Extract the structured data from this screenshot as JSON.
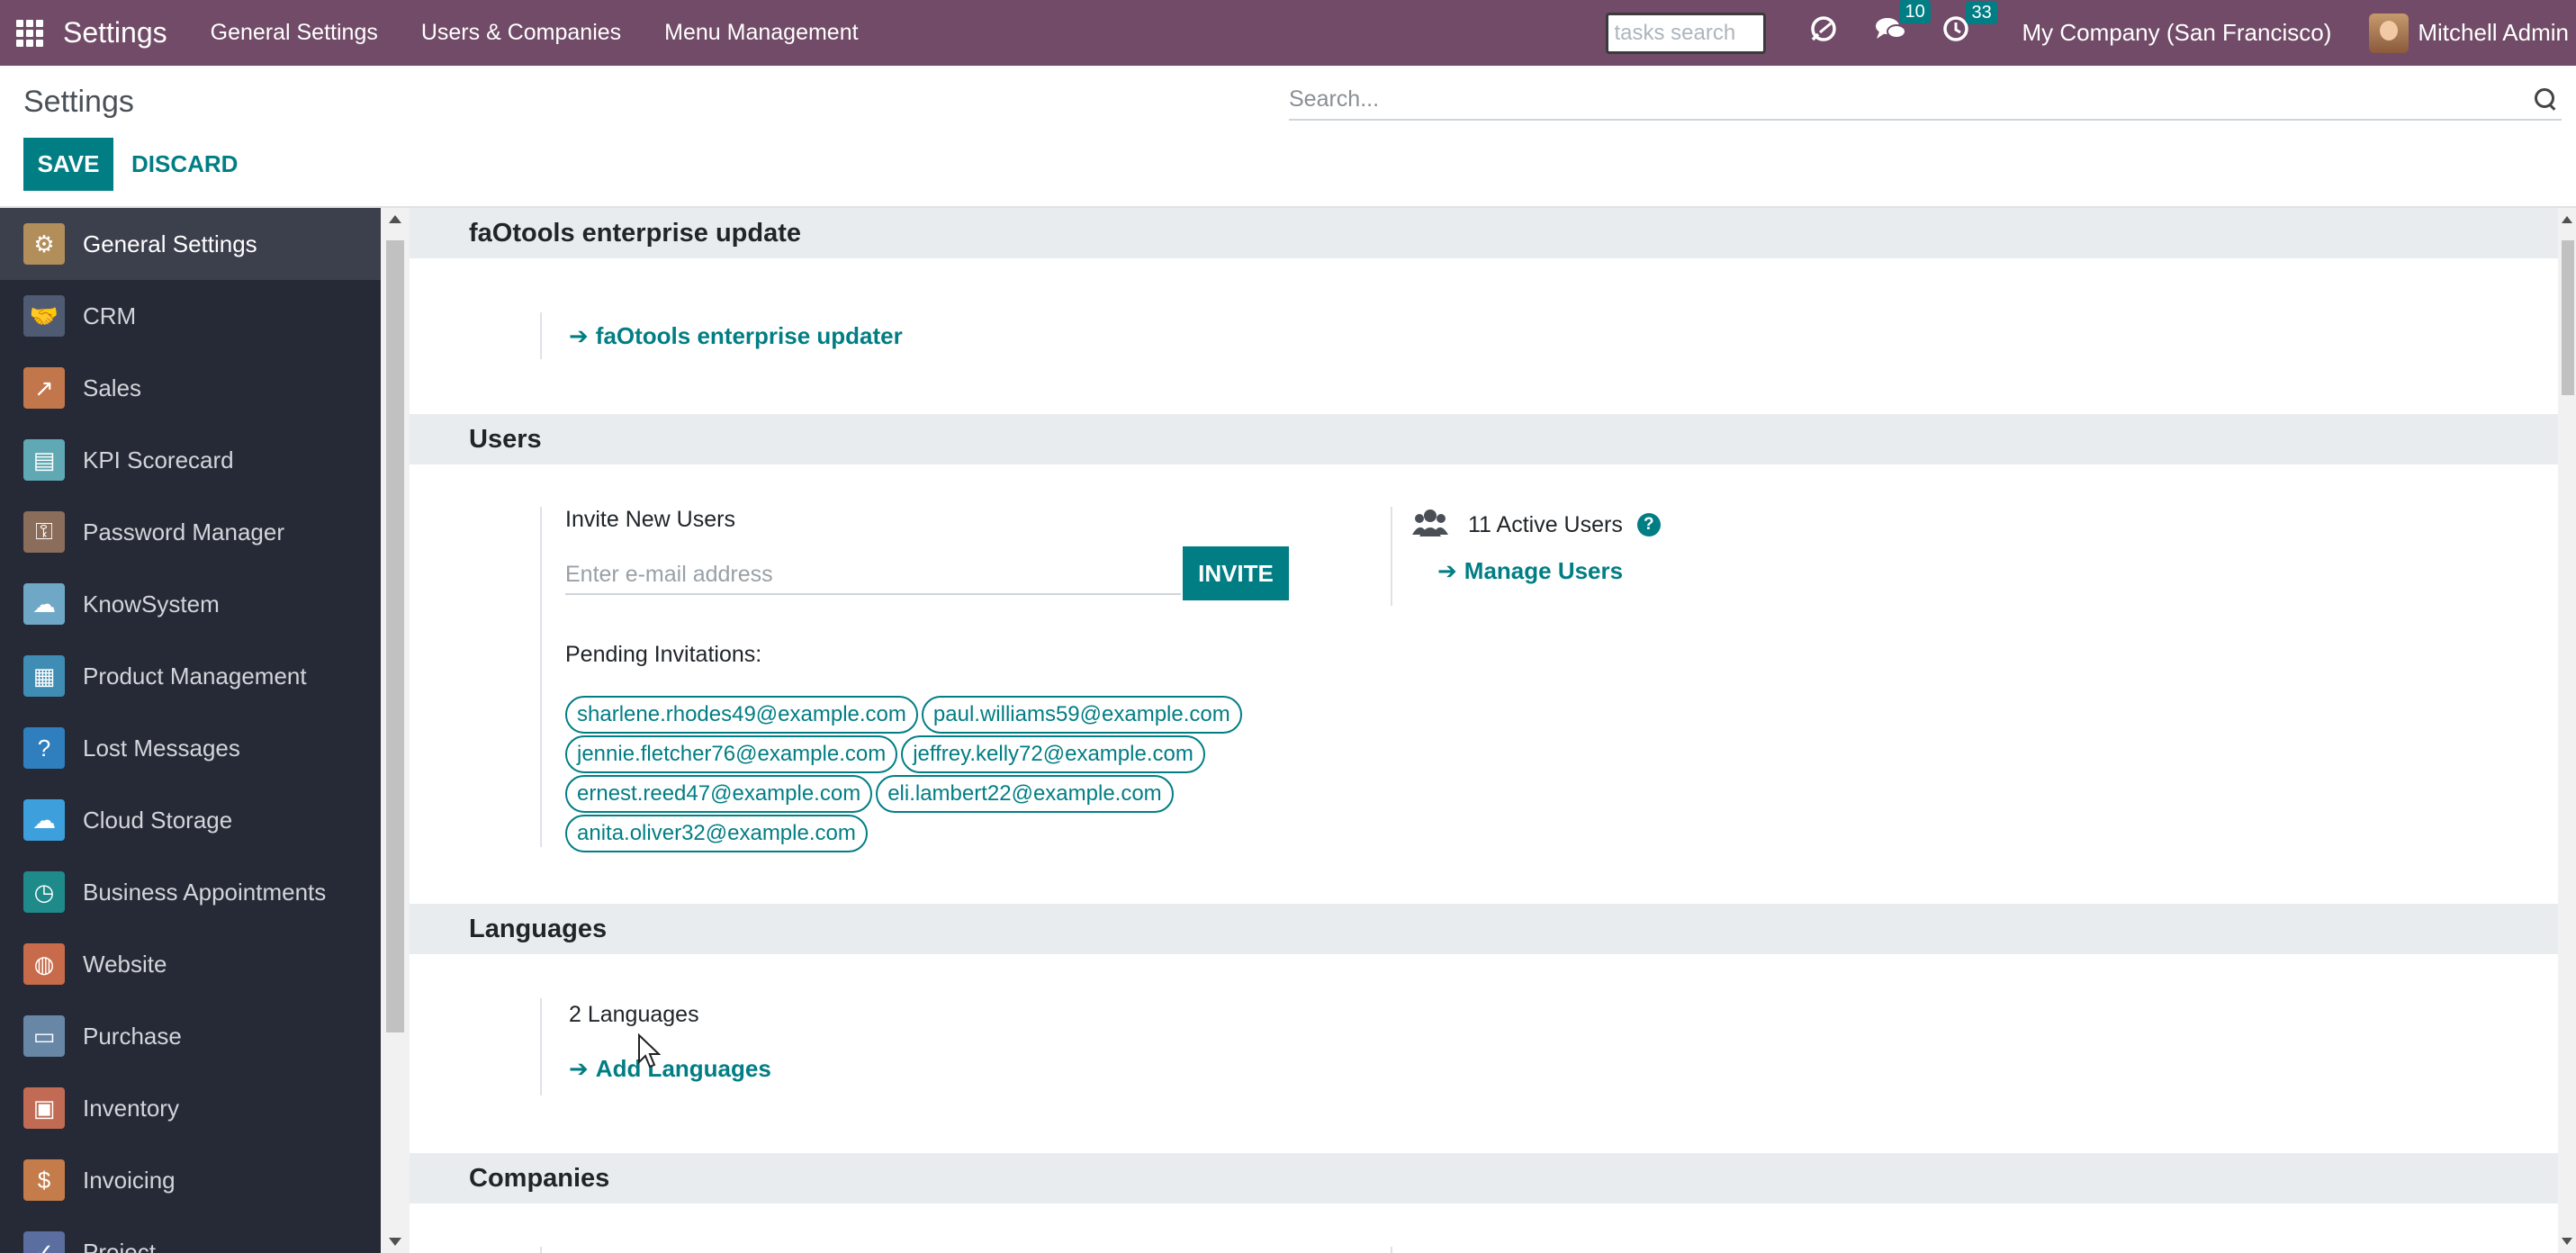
{
  "navbar": {
    "app_title": "Settings",
    "menus": [
      "General Settings",
      "Users & Companies",
      "Menu Management"
    ],
    "tasks_search_placeholder": "tasks search",
    "messages_badge": "10",
    "activities_badge": "33",
    "company": "My Company (San Francisco)",
    "user": "Mitchell Admin",
    "accent_color": "#714b67"
  },
  "control_panel": {
    "title": "Settings",
    "save_label": "SAVE",
    "discard_label": "DISCARD",
    "search_placeholder": "Search..."
  },
  "sidebar": {
    "items": [
      {
        "label": "General Settings",
        "icon": "gear-icon",
        "color": "#b18e5a"
      },
      {
        "label": "CRM",
        "icon": "handshake-icon",
        "color": "#4f5b72"
      },
      {
        "label": "Sales",
        "icon": "chart-up-icon",
        "color": "#c1774b"
      },
      {
        "label": "KPI Scorecard",
        "icon": "scorecard-icon",
        "color": "#5fa8b4"
      },
      {
        "label": "Password Manager",
        "icon": "key-icon",
        "color": "#8a6d5a"
      },
      {
        "label": "KnowSystem",
        "icon": "brain-icon",
        "color": "#6fa8c7"
      },
      {
        "label": "Product Management",
        "icon": "product-icon",
        "color": "#3f8db4"
      },
      {
        "label": "Lost Messages",
        "icon": "lost-user-icon",
        "color": "#2f7fbf"
      },
      {
        "label": "Cloud Storage",
        "icon": "cloud-icon",
        "color": "#3da0dd"
      },
      {
        "label": "Business Appointments",
        "icon": "clock-icon",
        "color": "#1e8a8a"
      },
      {
        "label": "Website",
        "icon": "globe-icon",
        "color": "#c76b4a"
      },
      {
        "label": "Purchase",
        "icon": "card-icon",
        "color": "#6887a6"
      },
      {
        "label": "Inventory",
        "icon": "box-icon",
        "color": "#c26b54"
      },
      {
        "label": "Invoicing",
        "icon": "invoice-icon",
        "color": "#c47c4a"
      },
      {
        "label": "Project",
        "icon": "project-icon",
        "color": "#5a6fa0"
      }
    ]
  },
  "sections": {
    "faotools": {
      "title": "faOtools enterprise update",
      "link": "faOtools enterprise updater"
    },
    "users": {
      "title": "Users",
      "invite_label": "Invite New Users",
      "email_placeholder": "Enter e-mail address",
      "invite_button": "INVITE",
      "pending_label": "Pending Invitations:",
      "pending": [
        "sharlene.rhodes49@example.com",
        "paul.williams59@example.com",
        "jennie.fletcher76@example.com",
        "jeffrey.kelly72@example.com",
        "ernest.reed47@example.com",
        "eli.lambert22@example.com",
        "anita.oliver32@example.com"
      ],
      "active_users": "11 Active Users",
      "manage_link": "Manage Users"
    },
    "languages": {
      "title": "Languages",
      "count": "2 Languages",
      "add_link": "Add Languages"
    },
    "companies": {
      "title": "Companies"
    }
  }
}
